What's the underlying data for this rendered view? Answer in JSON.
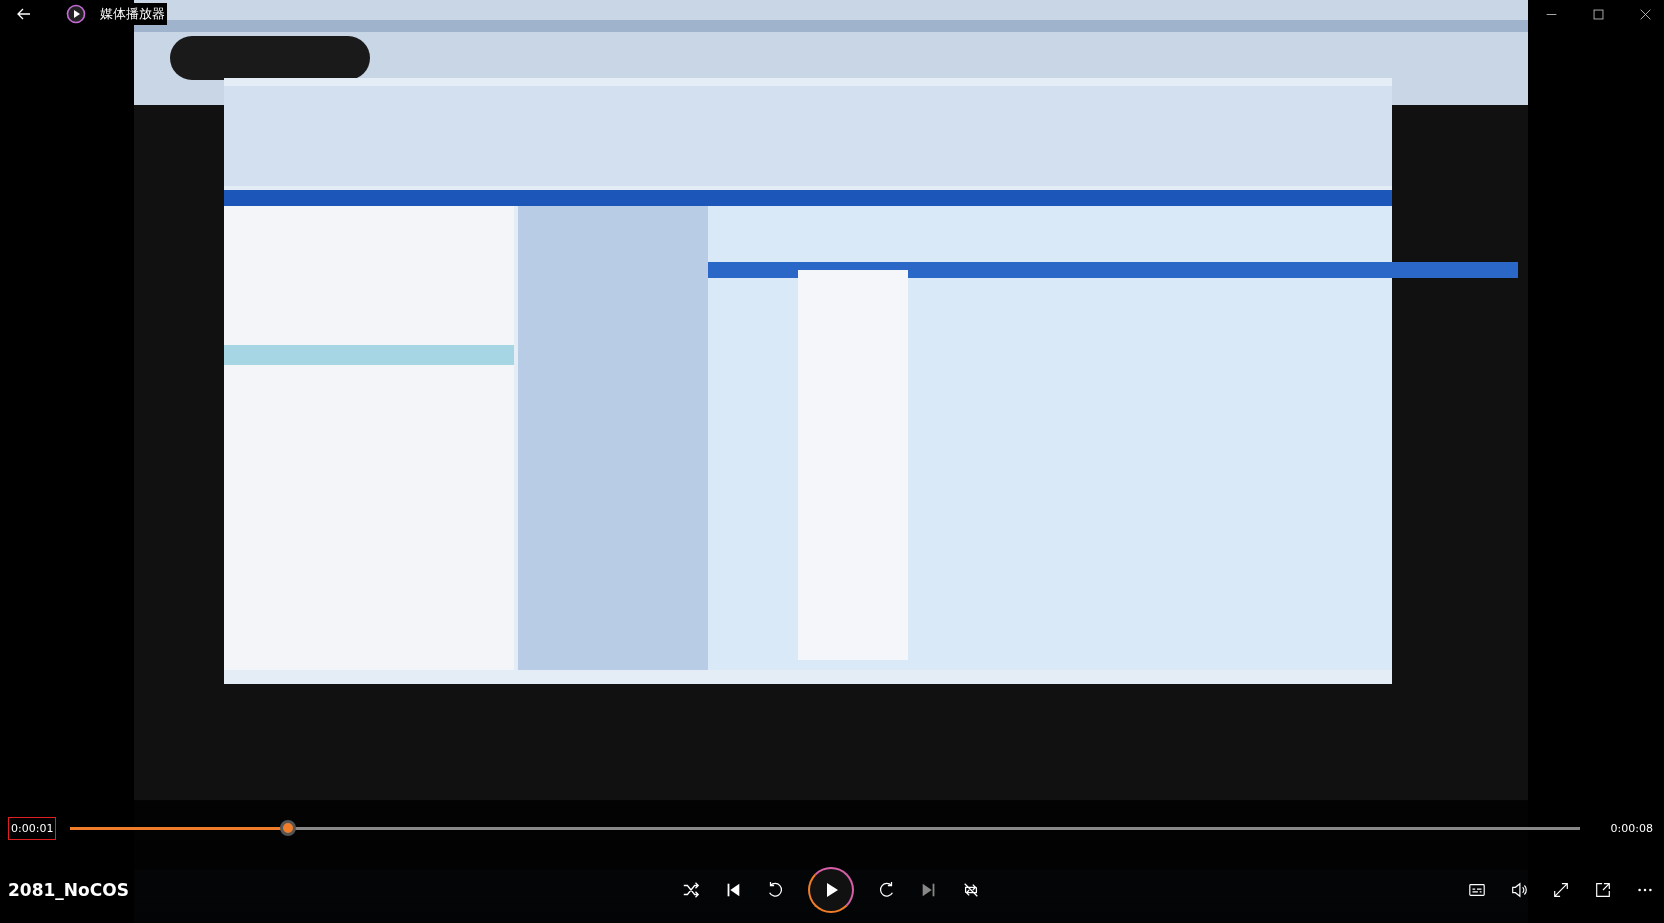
{
  "window": {
    "title": "媒体播放器"
  },
  "playback": {
    "current_time": "0:00:01",
    "current_time_focused": true,
    "total_time": "0:00:08",
    "level": 0.144,
    "playing": false
  },
  "media_title": "2081_NoCOS",
  "controls": [
    {
      "kind": "shuffle"
    },
    {
      "kind": "previous"
    },
    {
      "kind": "rewind"
    },
    {
      "kind": "play"
    },
    {
      "kind": "forward"
    },
    {
      "kind": "next"
    },
    {
      "kind": "repeat"
    }
  ],
  "side_controls": [
    {
      "kind": "subtitles"
    },
    {
      "kind": "volume"
    },
    {
      "kind": "fullscreen"
    },
    {
      "kind": "miniplayer"
    },
    {
      "kind": "more"
    }
  ]
}
